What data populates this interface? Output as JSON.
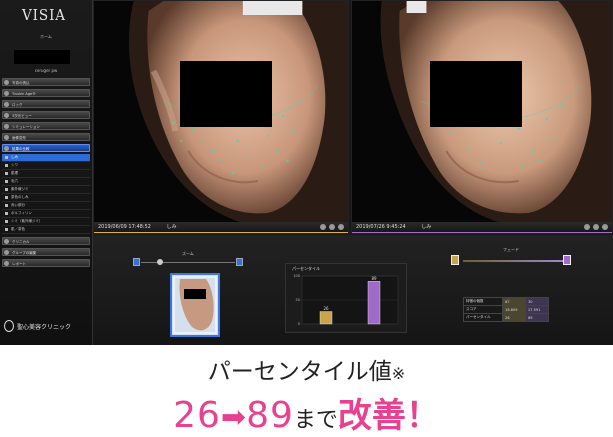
{
  "sidebar": {
    "logo": "VISIA",
    "logo_sub": "ホーム",
    "patient_name": "ceruger pw",
    "nav_top": [
      "写真の読込",
      "Truskin Age®",
      "ロック",
      "3次元ビュー",
      "シミュレーション",
      "画像変形"
    ],
    "nav_active": "結果の比較",
    "sub_items": [
      "しみ",
      "シワ",
      "肌理",
      "毛穴",
      "紫外線ジミ",
      "茶色のしみ",
      "赤い部分",
      "ポルフィリン",
      "シミ（紫外線ジミ）",
      "肌／茶色"
    ],
    "selected_sub": "しみ",
    "nav_bottom": [
      "クリニカル",
      "グループの編集",
      "レポート"
    ],
    "clinic": "聖心美容クリニック"
  },
  "left_panel": {
    "date": "2019/06/09 17:48:52",
    "tag": "しみ"
  },
  "right_panel": {
    "date": "2019/07/26 9:45:24",
    "tag": "しみ"
  },
  "controls": {
    "zoom_label": "ズーム",
    "fade_label": "フェード"
  },
  "chart_data": {
    "type": "bar",
    "title": "パーセンタイル",
    "categories": [
      "2019/06/09",
      "2019/07/26"
    ],
    "values": [
      26,
      89
    ],
    "ylim": [
      0,
      100
    ],
    "yticks": [
      0,
      50,
      100
    ],
    "colors": [
      "#c9a44a",
      "#a06ac8"
    ]
  },
  "stats_table": {
    "rows": [
      [
        "特徴の個数",
        "67",
        "30"
      ],
      [
        "スコア",
        "18.609",
        "27.591"
      ],
      [
        "パーセンタイル",
        "26",
        "89"
      ]
    ]
  },
  "caption": {
    "line1": "パーセンタイル値",
    "mark": "※",
    "from": "26",
    "arrow": "➡",
    "to": "89",
    "made": "まで",
    "improved": "改善！"
  },
  "colors": {
    "accent": "#e8418f",
    "active_nav": "#2b60c8",
    "left_sel": "#d8b04a",
    "right_sel": "#a06ac8"
  }
}
